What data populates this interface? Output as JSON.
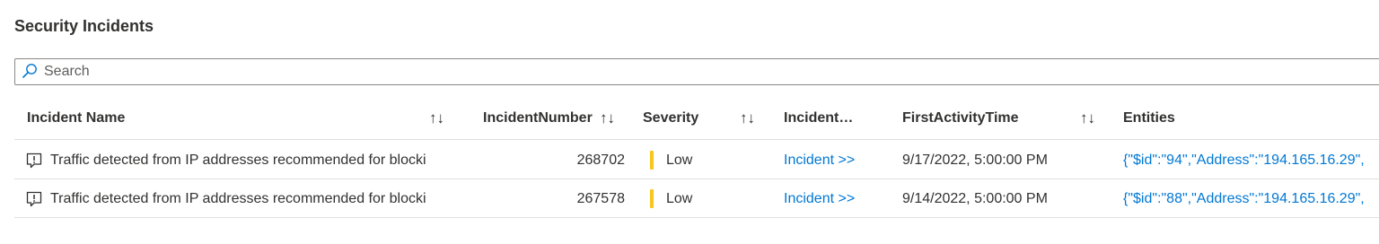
{
  "page": {
    "title": "Security Incidents"
  },
  "search": {
    "placeholder": "Search",
    "value": ""
  },
  "table": {
    "columns": [
      {
        "label": "Incident Name",
        "sortable": true
      },
      {
        "label": "IncidentNumber",
        "sortable": true
      },
      {
        "label": "Severity",
        "sortable": true
      },
      {
        "label": "Incident…",
        "sortable": false
      },
      {
        "label": "FirstActivityTime",
        "sortable": true
      },
      {
        "label": "Entities",
        "sortable": false
      }
    ],
    "sort_glyph": "↑↓",
    "rows": [
      {
        "name": "Traffic detected from IP addresses recommended for blocki",
        "number": "268702",
        "severity": "Low",
        "incident_link": "Incident >>",
        "first_activity": "9/17/2022, 5:00:00 PM",
        "entities": "{\"$id\":\"94\",\"Address\":\"194.165.16.29\","
      },
      {
        "name": "Traffic detected from IP addresses recommended for blocki",
        "number": "267578",
        "severity": "Low",
        "incident_link": "Incident >>",
        "first_activity": "9/14/2022, 5:00:00 PM",
        "entities": "{\"$id\":\"88\",\"Address\":\"194.165.16.29\","
      }
    ]
  },
  "colors": {
    "link": "#0078d4",
    "severity_low": "#f8c61d",
    "border": "#e1dfdd"
  },
  "icons": {
    "search": "search-icon",
    "incident": "incident-alert-icon"
  }
}
